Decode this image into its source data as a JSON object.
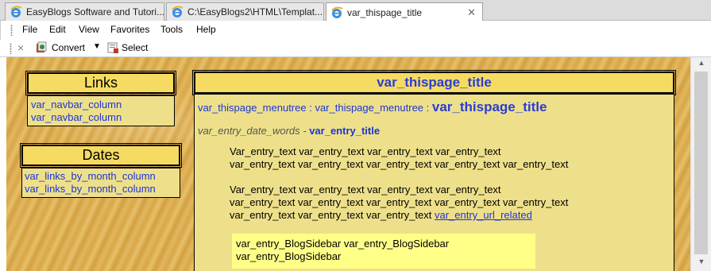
{
  "tabs": [
    {
      "label": "EasyBlogs Software and Tutori...",
      "active": false
    },
    {
      "label": "C:\\EasyBlogs2\\HTML\\Templat...",
      "active": false
    },
    {
      "label": "var_thispage_title",
      "active": true
    }
  ],
  "menu": {
    "items": [
      {
        "label": "File"
      },
      {
        "label": "Edit"
      },
      {
        "label": "View"
      },
      {
        "label": "Favorites"
      },
      {
        "label": "Tools"
      },
      {
        "label": "Help"
      }
    ]
  },
  "commandbar": {
    "close_glyph": "×",
    "convert_label": "Convert",
    "select_label": "Select"
  },
  "page": {
    "links_box": {
      "title": "Links",
      "items": [
        "var_navbar_column",
        "var_navbar_column"
      ]
    },
    "dates_box": {
      "title": "Dates",
      "items": [
        "var_links_by_month_column",
        "var_links_by_month_column"
      ]
    },
    "main": {
      "title": "var_thispage_title",
      "breadcrumb": {
        "part1": "var_thispage_menutree",
        "sep1": " : ",
        "part2": "var_thispage_menutree",
        "sep2": " : ",
        "current": "var_thispage_title"
      },
      "entry_date": "var_entry_date_words",
      "entry_sep": " - ",
      "entry_title": "var_entry_title",
      "paragraph1": [
        "Var_entry_text var_entry_text var_entry_text var_entry_text",
        "var_entry_text var_entry_text var_entry_text var_entry_text var_entry_text"
      ],
      "paragraph2": [
        "Var_entry_text var_entry_text var_entry_text var_entry_text",
        "var_entry_text var_entry_text var_entry_text var_entry_text var_entry_text"
      ],
      "paragraph2_last_text": "var_entry_text var_entry_text var_entry_text ",
      "related_link": "var_entry_url_related",
      "blog_sidebar": [
        "var_entry_BlogSidebar var_entry_BlogSidebar",
        "var_entry_BlogSidebar"
      ]
    }
  },
  "colors": {
    "link": "#1b35d8",
    "title_bg": "#f5db62",
    "box_bg": "#eee08a",
    "sidebar_note_bg": "#ffff88"
  }
}
